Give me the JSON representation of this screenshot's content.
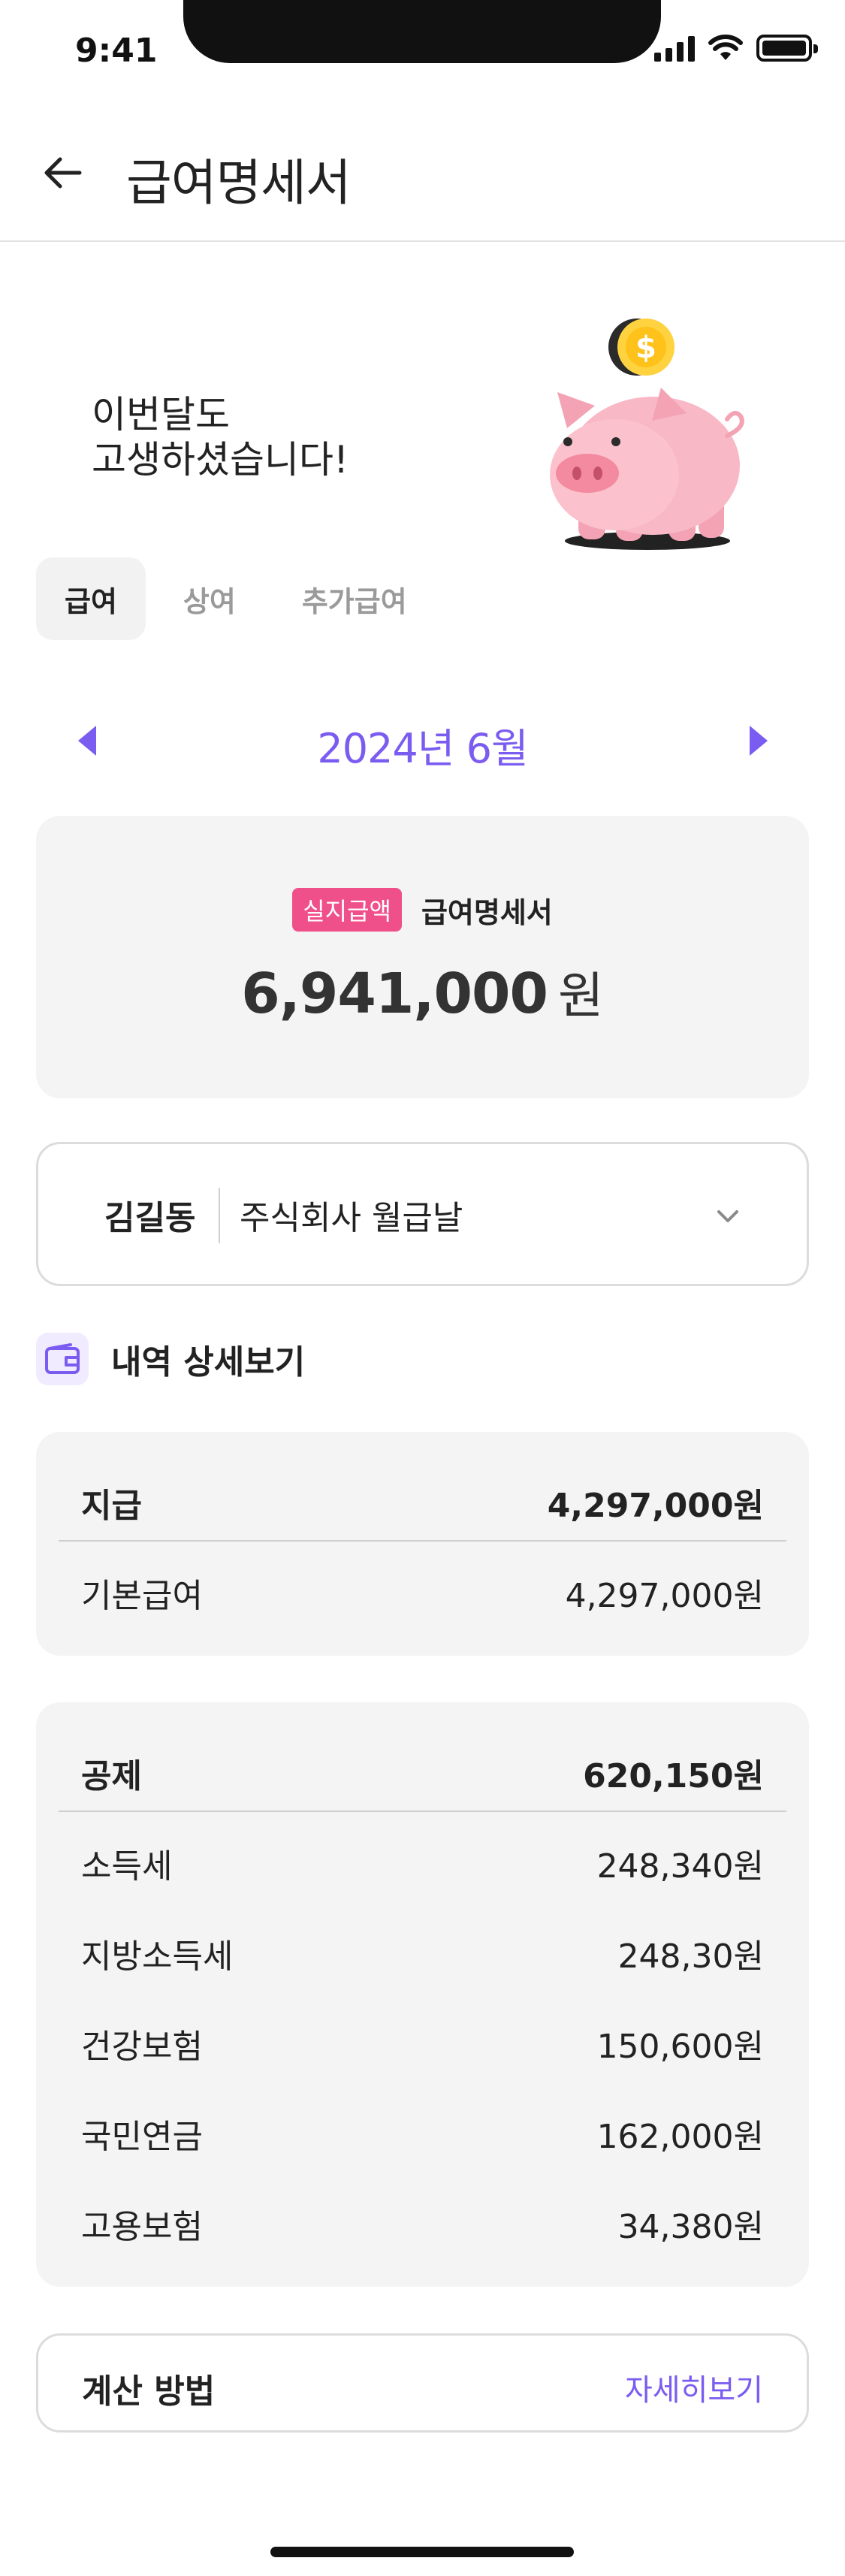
{
  "status_bar": {
    "time": "9:41"
  },
  "header": {
    "title": "급여명세서"
  },
  "hero": {
    "message": "이번달도\n고생하셨습니다!"
  },
  "tabs": [
    {
      "label": "급여",
      "active": true
    },
    {
      "label": "상여",
      "active": false
    },
    {
      "label": "추가급여",
      "active": false
    }
  ],
  "period": {
    "label": "2024년 6월"
  },
  "net_pay": {
    "badge": "실지급액",
    "title": "급여명세서",
    "amount": "6,941,000",
    "unit": "원"
  },
  "employee": {
    "name": "김길동",
    "company": "주식회사 월급날"
  },
  "details": {
    "title": "내역 상세보기"
  },
  "payment": {
    "label": "지급",
    "total": "4,297,000원",
    "items": [
      {
        "label": "기본급여",
        "value": "4,297,000원"
      }
    ]
  },
  "deduction": {
    "label": "공제",
    "total": "620,150원",
    "items": [
      {
        "label": "소득세",
        "value": "248,340원"
      },
      {
        "label": "지방소득세",
        "value": "248,30원"
      },
      {
        "label": "건강보험",
        "value": "150,600원"
      },
      {
        "label": "국민연금",
        "value": "162,000원"
      },
      {
        "label": "고용보험",
        "value": "34,380원"
      }
    ]
  },
  "calculation": {
    "title": "계산 방법",
    "link": "자세히보기"
  },
  "colors": {
    "accent": "#7b5cf0",
    "badge": "#f0508a",
    "card_bg": "#f4f4f4"
  }
}
